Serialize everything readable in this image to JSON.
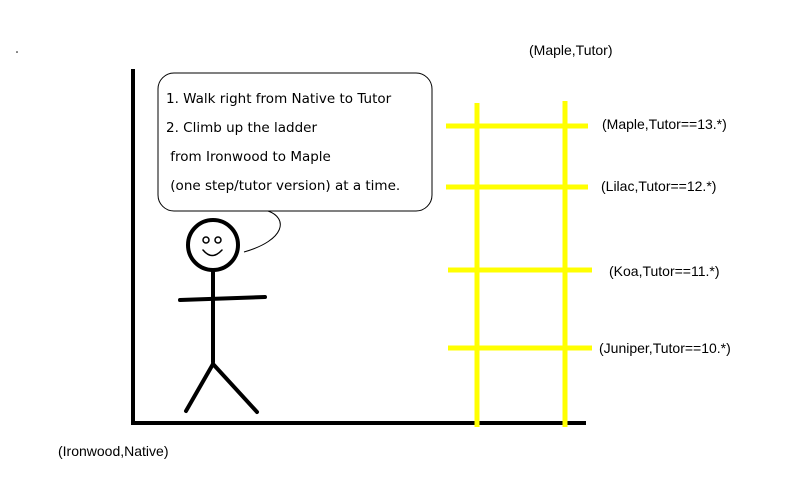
{
  "colors": {
    "background": "#ffffff",
    "ink": "#000000",
    "ladder": "#ffff00"
  },
  "labels": {
    "top": "(Maple,Tutor)",
    "origin": "(Ironwood,Native)"
  },
  "rungs": [
    {
      "label": "(Maple,Tutor==13.*)"
    },
    {
      "label": "(Lilac,Tutor==12.*)"
    },
    {
      "label": "(Koa,Tutor==11.*)"
    },
    {
      "label": "(Juniper,Tutor==10.*)"
    }
  ],
  "speech_bubble": {
    "lines": [
      "1. Walk right from Native to Tutor",
      "2. Climb up the ladder",
      " from Ironwood to Maple",
      " (one step/tutor version) at a time."
    ]
  }
}
